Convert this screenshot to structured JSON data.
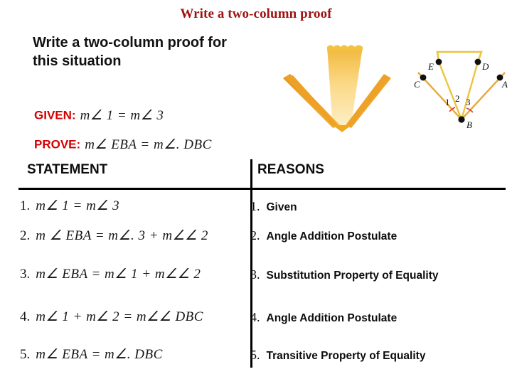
{
  "slide": {
    "title": "Write a two-column proof",
    "prompt_line1": "Write a two-column proof for",
    "prompt_line2": "this situation",
    "title_color": "#9e1212",
    "label_color": "#d40000",
    "figure_color": "#e8b93a",
    "burst_color": "#f0a21e"
  },
  "given": {
    "label": "GIVEN:",
    "statement": "m∠ 1 = m∠  3"
  },
  "prove": {
    "label": "PROVE:",
    "statement": "m∠  EBA = m∠.  DBC"
  },
  "table": {
    "header_statement": "STATEMENT",
    "header_reasons": "REASONS",
    "rows": [
      {
        "num": "1.",
        "statement": "m∠ 1 = m∠  3",
        "reason_num": "1.",
        "reason": "Given"
      },
      {
        "num": "2.",
        "statement": "m ∠  EBA = m∠.  3 + m∠∠ 2",
        "reason_num": "2.",
        "reason": "Angle Addition Postulate"
      },
      {
        "num": "3.",
        "statement": "m∠  EBA = m∠  1 + m∠∠ 2",
        "reason_num": "3.",
        "reason": "Substitution Property of Equality"
      },
      {
        "num": "4.",
        "statement": "m∠ 1 + m∠  2 = m∠∠  DBC",
        "reason_num": "4.",
        "reason": "Angle Addition Postulate"
      },
      {
        "num": "5.",
        "statement": "m∠  EBA = m∠.  DBC",
        "reason_num": "5.",
        "reason": "Transitive Property of Equality"
      }
    ]
  },
  "figure": {
    "points": [
      "E",
      "D",
      "C",
      "A",
      "B"
    ],
    "angles": [
      "1",
      "2",
      "3"
    ]
  }
}
